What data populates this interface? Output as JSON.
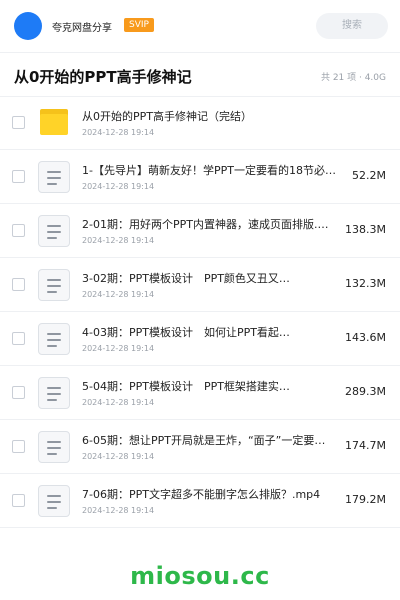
{
  "header": {
    "share_name": "夸克网盘分享",
    "badge": "SVIP",
    "search_placeholder": "搜索"
  },
  "folder": {
    "title": "从0开始的PPT高手修神记",
    "meta": "共 21 项 · 4.0G"
  },
  "items": [
    {
      "type": "folder",
      "icon": "folder-icon",
      "name": "从0开始的PPT高手修神记（完结）",
      "date": "2024-12-28 19:14",
      "size": ""
    },
    {
      "type": "file",
      "icon": "file-icon",
      "name": "1-【先导片】萌新友好！学PPT一定要看的18节必…",
      "date": "2024-12-28 19:14",
      "size": "52.2M"
    },
    {
      "type": "file",
      "icon": "file-icon",
      "name": "2-01期：用好两个PPT内置神器，速成页面排版.…",
      "date": "2024-12-28 19:14",
      "size": "138.3M"
    },
    {
      "type": "file",
      "icon": "file-icon",
      "name": "3-02期：PPT模板设计　PPT颜色又丑又…",
      "date": "2024-12-28 19:14",
      "size": "132.3M"
    },
    {
      "type": "file",
      "icon": "file-icon",
      "name": "4-03期：PPT模板设计　如何让PPT看起…",
      "date": "2024-12-28 19:14",
      "size": "143.6M"
    },
    {
      "type": "file",
      "icon": "file-icon",
      "name": "5-04期：PPT模板设计　PPT框架搭建实…",
      "date": "2024-12-28 19:14",
      "size": "289.3M"
    },
    {
      "type": "file",
      "icon": "file-icon",
      "name": "6-05期：想让PPT开局就是王炸，“面子”一定要…",
      "date": "2024-12-28 19:14",
      "size": "174.7M"
    },
    {
      "type": "file",
      "icon": "file-icon",
      "name": "7-06期：PPT文字超多不能删字怎么排版？.mp4",
      "date": "2024-12-28 19:14",
      "size": "179.2M"
    }
  ],
  "watermark": "miosou.cc",
  "colors": {
    "accent": "#1e7bf6",
    "badge": "#f89a1c",
    "folder": "#ffd328",
    "watermark": "#2eb84a"
  }
}
